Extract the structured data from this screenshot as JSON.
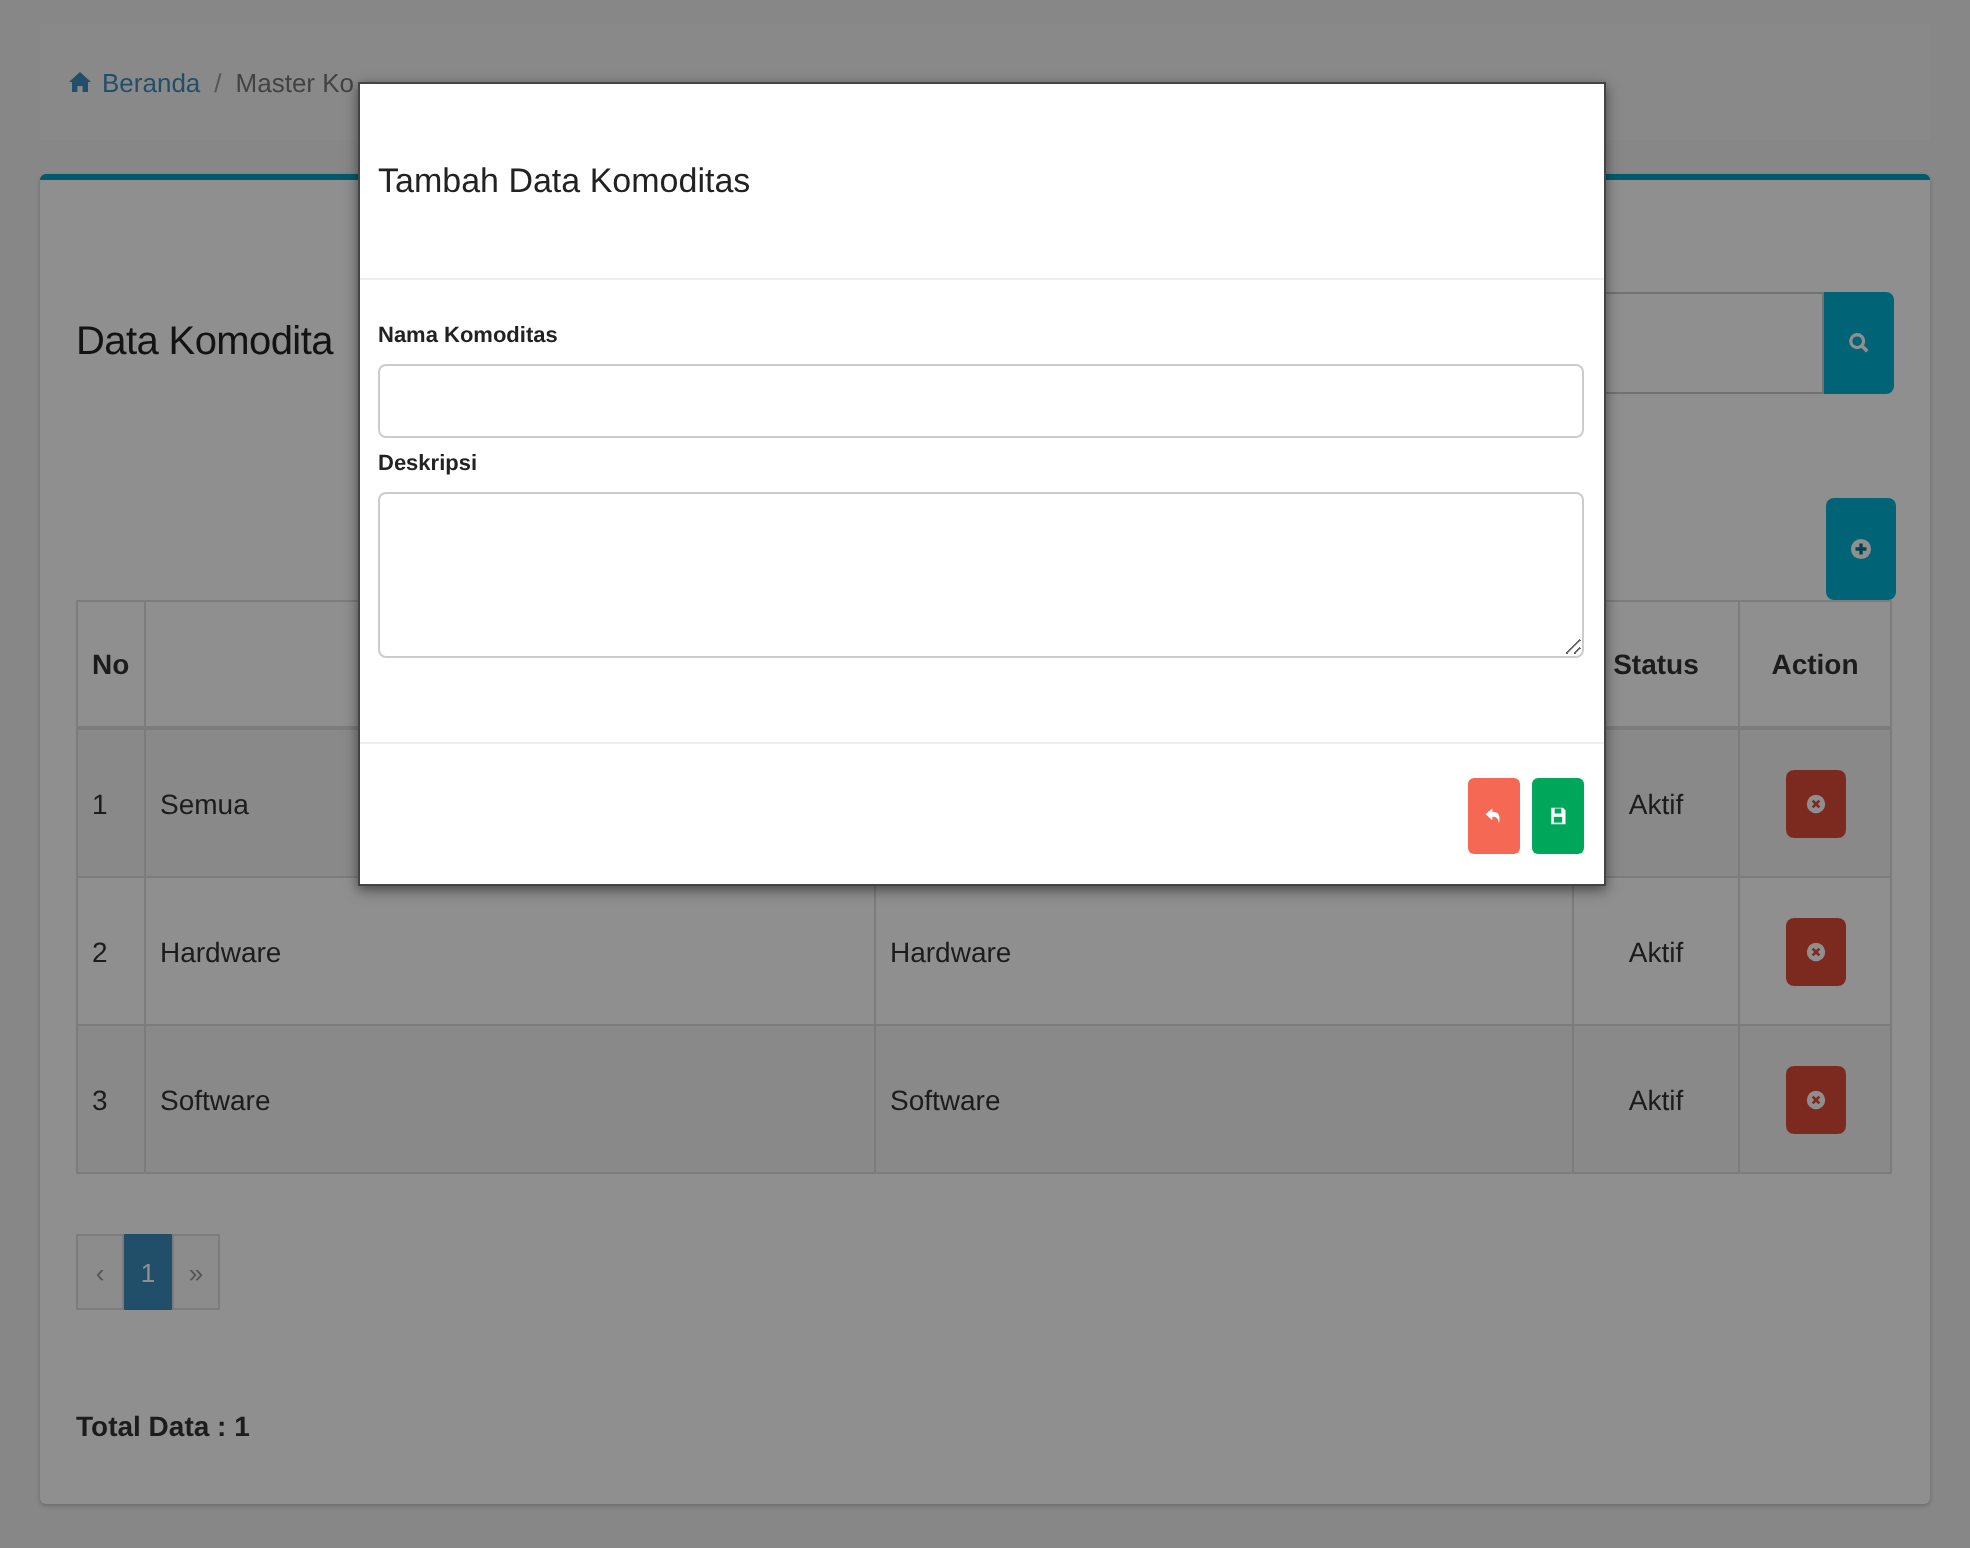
{
  "breadcrumb_separator": "/",
  "breadcrumb": [
    {
      "label": "Beranda",
      "kind": "home"
    },
    {
      "label": "Master Ko",
      "kind": "current"
    }
  ],
  "page_title": "Data Komodita",
  "table": {
    "columns": [
      {
        "label": "No"
      },
      {},
      {},
      {
        "label": "Status"
      },
      {
        "label": "Action"
      }
    ],
    "rows": [
      {
        "no": "1",
        "name": "Semua",
        "status": "Aktif"
      },
      {
        "no": "2",
        "name": "Hardware",
        "description": "Hardware",
        "status": "Aktif"
      },
      {
        "no": "3",
        "name": "Software",
        "description": "Software",
        "status": "Aktif"
      }
    ]
  },
  "pagination": [
    {
      "label": "‹",
      "selected": false
    },
    {
      "label": "1",
      "selected": true
    },
    {
      "label": "»",
      "selected": false
    }
  ],
  "total": "Total Data : 1",
  "modal": {
    "title": "Tambah Data Komoditas",
    "fields": [
      {
        "label": "Nama Komoditas",
        "kind": "input"
      },
      {
        "label": "Deskripsi",
        "kind": "textarea"
      }
    ]
  }
}
